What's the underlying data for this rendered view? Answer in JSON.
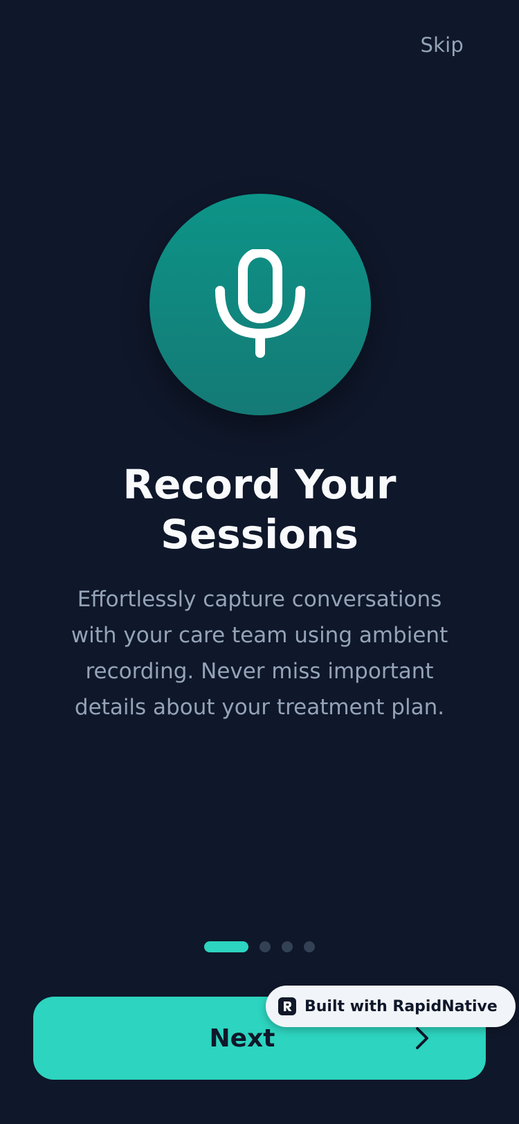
{
  "header": {
    "skip_label": "Skip"
  },
  "hero": {
    "icon": "microphone-icon"
  },
  "onboarding": {
    "title_line1": "Record Your",
    "title_line2": "Sessions",
    "description": "Effortlessly capture conversations with your care team using ambient recording. Never miss important details about your treatment plan."
  },
  "pagination": {
    "total": 4,
    "current": 1
  },
  "actions": {
    "next_label": "Next",
    "next_icon": "chevron-right-icon"
  },
  "badge": {
    "label": "Built with RapidNative",
    "icon": "rapidnative-logo-icon"
  },
  "colors": {
    "background": "#0F172A",
    "accent": "#2DD4BF",
    "hero_circle": "#0D9488",
    "muted_text": "#94A3B8",
    "dot_inactive": "#334155"
  }
}
